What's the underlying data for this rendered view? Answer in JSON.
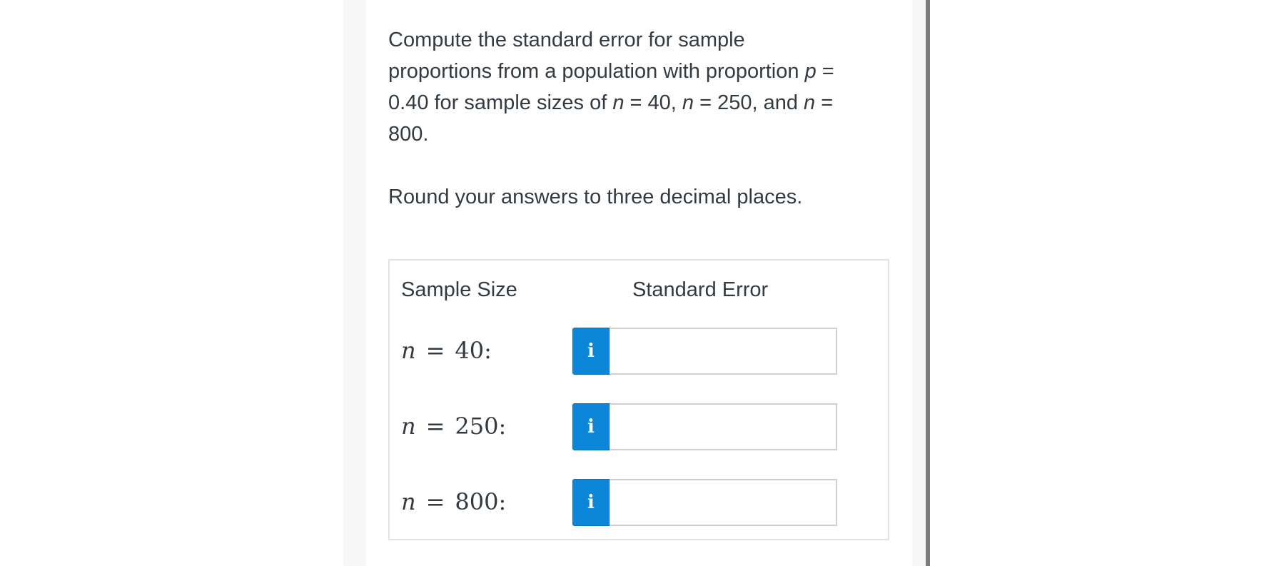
{
  "question": {
    "line1": "Compute the standard error for sample",
    "line2_prefix": "proportions from a population with proportion ",
    "var_p": "p",
    "line2_suffix": " =",
    "line3_prefix": "0.40 for sample sizes of ",
    "var_n1": "n",
    "line3_mid1": " = 40, ",
    "var_n2": "n",
    "line3_mid2": " = 250, and ",
    "var_n3": "n",
    "line3_suffix": " =",
    "line4": "800.",
    "instruction": "Round your answers to three decimal places."
  },
  "table": {
    "header_sample_size": "Sample Size",
    "header_standard_error": "Standard Error",
    "rows": [
      {
        "var": "n",
        "eq": "=",
        "value": "40:",
        "info_glyph": "i",
        "input_value": ""
      },
      {
        "var": "n",
        "eq": "=",
        "value": "250:",
        "info_glyph": "i",
        "input_value": ""
      },
      {
        "var": "n",
        "eq": "=",
        "value": "800:",
        "info_glyph": "i",
        "input_value": ""
      }
    ]
  },
  "colors": {
    "info_button": "#0b86d9",
    "text": "#333a42",
    "table_border": "#e2e2e2",
    "right_rule": "#7b7b7b"
  }
}
